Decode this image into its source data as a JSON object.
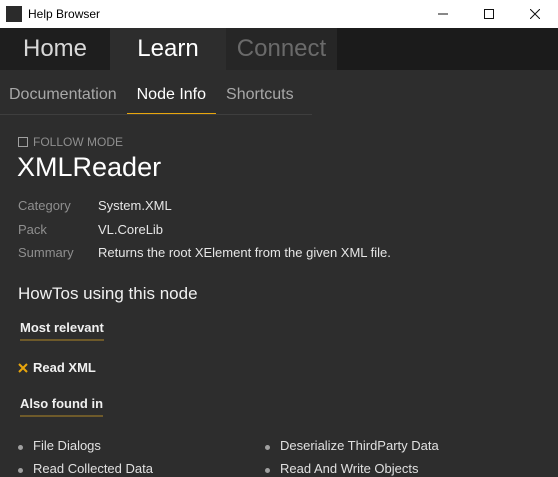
{
  "window": {
    "title": "Help Browser"
  },
  "main_tabs": [
    {
      "label": "Home"
    },
    {
      "label": "Learn"
    },
    {
      "label": "Connect"
    }
  ],
  "sub_tabs": [
    {
      "label": "Documentation"
    },
    {
      "label": "Node Info"
    },
    {
      "label": "Shortcuts"
    }
  ],
  "follow_mode": {
    "label": "FOLLOW MODE",
    "checked": false
  },
  "node": {
    "name": "XMLReader",
    "properties": [
      {
        "key": "Category",
        "value": "System.XML"
      },
      {
        "key": "Pack",
        "value": "VL.CoreLib"
      },
      {
        "key": "Summary",
        "value": "Returns the root XElement from the given XML file."
      }
    ]
  },
  "howtos": {
    "title": "HowTos using this node",
    "most_relevant_label": "Most relevant",
    "most_relevant": [
      {
        "label": "Read XML",
        "icon": "cross-icon"
      }
    ],
    "also_found_label": "Also found in",
    "also_found_left": [
      {
        "label": "File Dialogs"
      },
      {
        "label": "Read Collected Data"
      }
    ],
    "also_found_right": [
      {
        "label": "Deserialize ThirdParty Data"
      },
      {
        "label": "Read And Write Objects"
      }
    ]
  },
  "colors": {
    "accent": "#e8a60d",
    "background": "#2d2d2d",
    "tabbar": "#1b1b1b"
  }
}
